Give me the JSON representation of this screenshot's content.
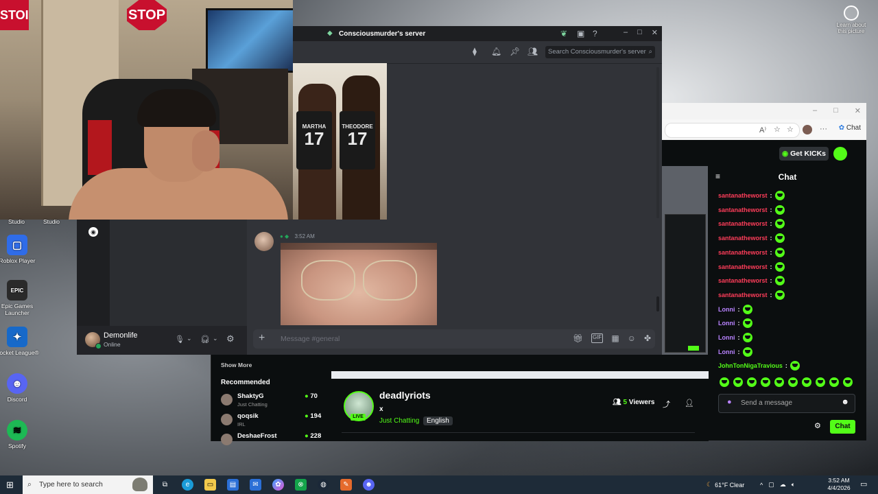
{
  "desktop": {
    "top_right_icon_label": "Learn about this picture",
    "icons": [
      {
        "label": "Studio",
        "pos": "a"
      },
      {
        "label": "Studio",
        "pos": "b"
      },
      {
        "label": "Roblox Player"
      },
      {
        "label": "Epic Games Launcher"
      },
      {
        "label": "Rocket League®"
      },
      {
        "label": "Discord"
      },
      {
        "label": "Spotify"
      }
    ]
  },
  "webcam": {
    "stop_sign": "STOP",
    "stop_sign2": "STOI"
  },
  "discord_top": {
    "title": "Consciousmurder's server",
    "search_placeholder": "Search Consciousmurder's server",
    "jersey_left_name": "MARTHA",
    "jersey_left_no": "17",
    "jersey_right_name": "THEODORE",
    "jersey_right_no": "17"
  },
  "discord_bottom": {
    "message_time": "3:52 AM",
    "username": "Demonlife",
    "status": "Online",
    "message_placeholder": "Message #general"
  },
  "kick": {
    "get_kicks": "Get KICKs",
    "browser_chat": "Chat",
    "chat_title": "Chat",
    "messages": [
      {
        "user": "santanatheworst",
        "sep": ":",
        "color": "#ff3d5a"
      },
      {
        "user": "santanatheworst",
        "sep": ":",
        "color": "#ff3d5a"
      },
      {
        "user": "santanatheworst",
        "sep": ":",
        "color": "#ff3d5a"
      },
      {
        "user": "santanatheworst",
        "sep": ":",
        "color": "#ff3d5a"
      },
      {
        "user": "santanatheworst",
        "sep": ":",
        "color": "#ff3d5a"
      },
      {
        "user": "santanatheworst",
        "sep": ":",
        "color": "#ff3d5a"
      },
      {
        "user": "santanatheworst",
        "sep": ":",
        "color": "#ff3d5a"
      },
      {
        "user": "santanatheworst",
        "sep": ":",
        "color": "#ff3d5a"
      },
      {
        "user": "Lonni",
        "sep": ":",
        "color": "#b983ff"
      },
      {
        "user": "Lonni",
        "sep": ":",
        "color": "#b983ff"
      },
      {
        "user": "Lonni",
        "sep": ":",
        "color": "#b983ff"
      },
      {
        "user": "Lonni",
        "sep": ":",
        "color": "#b983ff"
      },
      {
        "user": "JohnTonNigaTravious",
        "sep": ":",
        "color": "#53fc18"
      }
    ],
    "send_placeholder": "Send a message",
    "send_button": "Chat",
    "show_more": "Show More",
    "recommended": "Recommended",
    "rec_channels": [
      {
        "name": "ShaktyG",
        "category": "Just Chatting",
        "viewers": "70"
      },
      {
        "name": "qoqsik",
        "category": "IRL",
        "viewers": "194"
      },
      {
        "name": "DeshaeFrost",
        "category": "",
        "viewers": "228"
      }
    ],
    "streamer": "deadlyriots",
    "stream_title": "x",
    "live": "LIVE",
    "category": "Just Chatting",
    "language": "English",
    "viewers_count": "5",
    "viewers_word": "Viewers"
  },
  "taskbar": {
    "search_placeholder": "Type here to search",
    "weather": "61°F  Clear",
    "time": "3:52 AM",
    "date": "4/4/2026"
  },
  "colors": {
    "kick_green": "#53fc18",
    "discord_bg": "#313338"
  }
}
